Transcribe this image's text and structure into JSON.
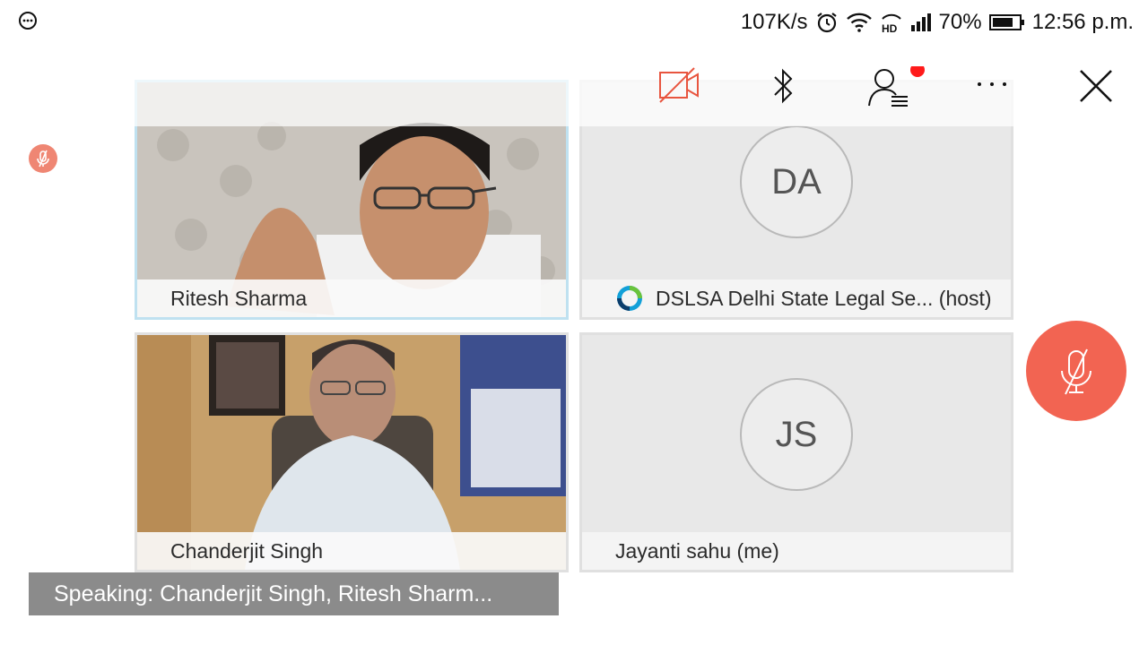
{
  "status_bar": {
    "speed": "107K/s",
    "battery": "70%",
    "time": "12:56 p.m.",
    "icons": [
      "options-icon",
      "alarm-icon",
      "wifi-icon",
      "hd-icon",
      "signal-icon",
      "battery-icon"
    ]
  },
  "toolbar": {
    "icons": [
      "video-off-icon",
      "bluetooth-icon",
      "participants-icon",
      "more-icon",
      "close-icon"
    ],
    "colors": {
      "video_off": "#e8553f",
      "notification_dot": "#ff1a1a"
    }
  },
  "participants": [
    {
      "name": "Ritesh Sharma",
      "type": "video"
    },
    {
      "initials": "DA",
      "name": "DSLSA Delhi State Legal Se... (host)",
      "type": "avatar"
    },
    {
      "name": "Chanderjit Singh",
      "type": "video"
    },
    {
      "initials": "JS",
      "name": "Jayanti sahu (me)",
      "type": "avatar"
    }
  ],
  "speaking": "Speaking: Chanderjit Singh, Ritesh Sharm...",
  "colors": {
    "mute_button": "#f26452",
    "speaking_bar": "#8b8b8b",
    "active_tile_border": "#bfe1f0"
  }
}
